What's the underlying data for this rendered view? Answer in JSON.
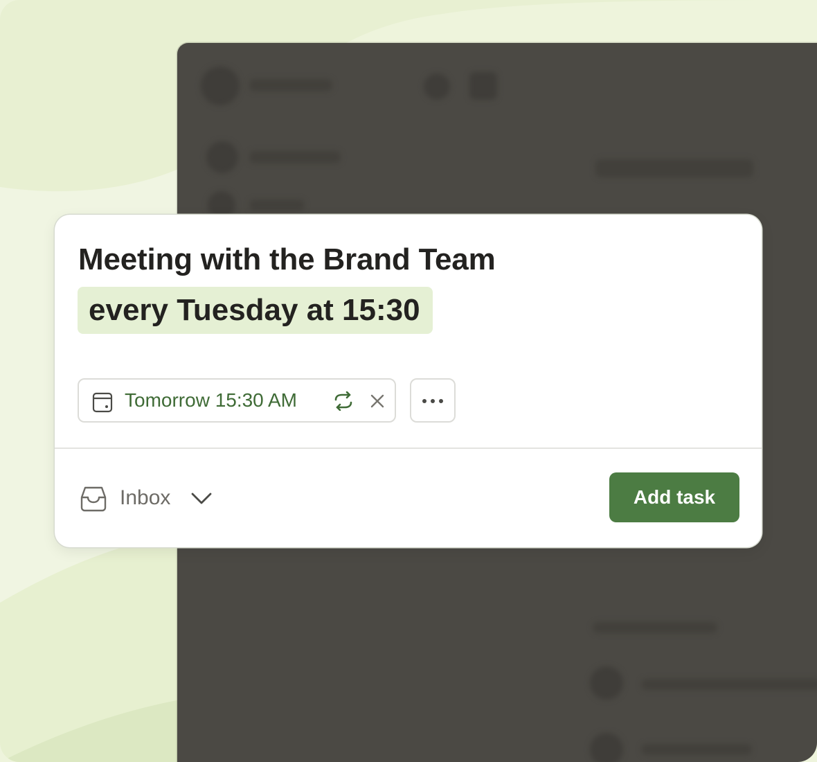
{
  "task": {
    "title": "Meeting with the Brand Team",
    "recurrence_text": "every Tuesday at 15:30"
  },
  "due_date": {
    "label": "Tomorrow 15:30 AM",
    "icon": "calendar-icon",
    "repeat_icon": "repeat-icon",
    "clear_icon": "close-icon"
  },
  "more": {
    "icon": "more-horizontal-icon"
  },
  "project": {
    "label": "Inbox",
    "icon": "inbox-icon",
    "dropdown_icon": "chevron-down-icon"
  },
  "actions": {
    "add_task_label": "Add task"
  },
  "colors": {
    "accent": "#4c7c43",
    "date_text": "#3f6b36",
    "highlight_bg": "#e5f0d4",
    "background": "#eef4dc",
    "overlay": "#4b4944"
  }
}
